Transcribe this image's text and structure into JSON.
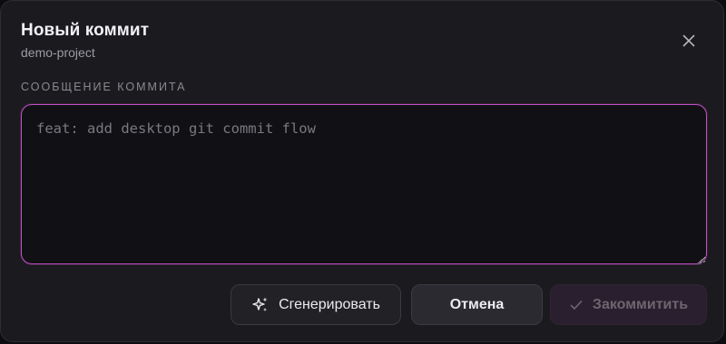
{
  "dialog": {
    "title": "Новый коммит",
    "subtitle": "demo-project",
    "close_icon": "close-icon"
  },
  "commit_message": {
    "label": "СООБЩЕНИЕ КОММИТА",
    "value": "",
    "placeholder": "feat: add desktop git commit flow"
  },
  "actions": {
    "generate_label": "Сгенерировать",
    "generate_icon": "sparkles-icon",
    "cancel_label": "Отмена",
    "commit_label": "Закоммитить",
    "commit_icon": "check-icon",
    "commit_disabled": true
  },
  "colors": {
    "focus_border": "#c050c8",
    "dialog_bg": "#1b1a1e",
    "commit_disabled_bg": "#2a1f2e"
  }
}
